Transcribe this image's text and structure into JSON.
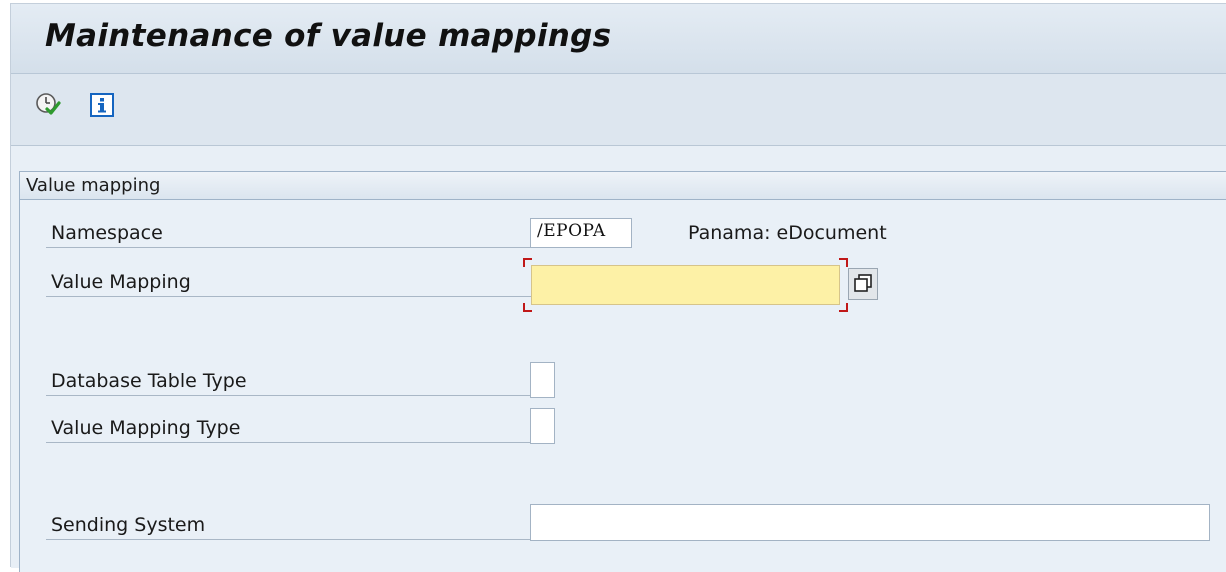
{
  "screen": {
    "title": "Maintenance of value mappings"
  },
  "toolbar": {
    "execute_icon": "execute-clock-check-icon",
    "info_icon": "info-icon"
  },
  "group": {
    "title": "Value mapping"
  },
  "fields": {
    "namespace": {
      "label": "Namespace",
      "value": "/EPOPA",
      "description": "Panama: eDocument"
    },
    "value_mapping": {
      "label": "Value Mapping",
      "value": "",
      "value_help_icon": "value-help-icon"
    },
    "database_table_type": {
      "label": "Database Table Type",
      "value": ""
    },
    "value_mapping_type": {
      "label": "Value Mapping Type",
      "value": ""
    },
    "sending_system": {
      "label": "Sending System",
      "value": ""
    }
  },
  "colors": {
    "background": "#dfe8f1",
    "required_field": "#fdf1a6",
    "focus_corner": "#c01818",
    "info_blue": "#1565c0"
  }
}
